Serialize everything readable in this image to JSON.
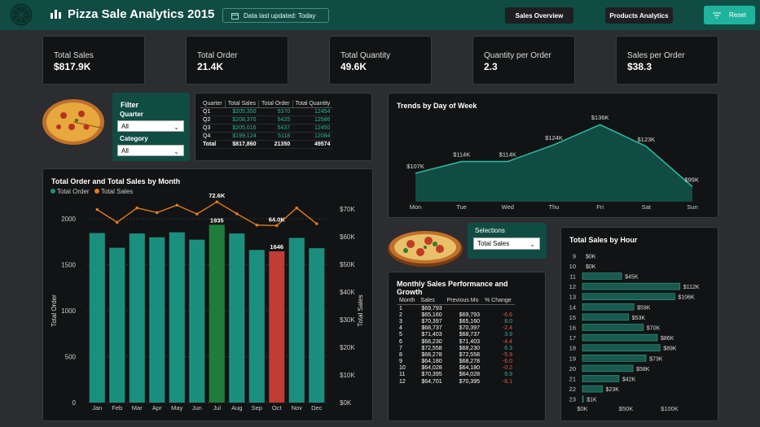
{
  "header": {
    "title": "Pizza Sale Analytics 2015",
    "updated": "Data last updated: Today",
    "nav": [
      "Sales Overview",
      "Products Analytics"
    ],
    "reset": "Reset"
  },
  "kpis": [
    {
      "label": "Total Sales",
      "value": "$817.9K"
    },
    {
      "label": "Total Order",
      "value": "21.4K"
    },
    {
      "label": "Total Quantity",
      "value": "49.6K"
    },
    {
      "label": "Quantity per Order",
      "value": "2.3"
    },
    {
      "label": "Sales per Order",
      "value": "$38.3"
    }
  ],
  "filter": {
    "title": "Filter",
    "quarter_label": "Quarter",
    "quarter_value": "All",
    "category_label": "Category",
    "category_value": "All"
  },
  "quarter_table": {
    "headers": [
      "Quarter",
      "Total Sales",
      "Total Order",
      "Total Quantity"
    ],
    "rows": [
      [
        "Q1",
        "$205,350",
        "5370",
        "12454"
      ],
      [
        "Q2",
        "$208,370",
        "5425",
        "12586"
      ],
      [
        "Q3",
        "$205,016",
        "5437",
        "12450"
      ],
      [
        "Q4",
        "$199,124",
        "5118",
        "12084"
      ],
      [
        "Total",
        "$817,860",
        "21350",
        "49574"
      ]
    ]
  },
  "selections": {
    "label": "Selections",
    "value": "Total Sales"
  },
  "monthly_perf": {
    "title": "Monthly Sales Performance and Growth",
    "headers": [
      "Month",
      "Sales",
      "Previous Mo",
      "% Change"
    ],
    "rows": [
      [
        "1",
        "$69,793",
        "",
        ""
      ],
      [
        "2",
        "$65,160",
        "$69,793",
        "-6.6"
      ],
      [
        "3",
        "$70,397",
        "$65,160",
        "8.0"
      ],
      [
        "4",
        "$68,737",
        "$70,397",
        "-2.4"
      ],
      [
        "5",
        "$71,403",
        "$68,737",
        "3.9"
      ],
      [
        "6",
        "$68,230",
        "$71,403",
        "-4.4"
      ],
      [
        "7",
        "$72,558",
        "$68,230",
        "6.3"
      ],
      [
        "8",
        "$68,278",
        "$72,558",
        "-5.9"
      ],
      [
        "9",
        "$64,180",
        "$68,278",
        "-6.0"
      ],
      [
        "10",
        "$64,028",
        "$64,180",
        "-0.2"
      ],
      [
        "11",
        "$70,395",
        "$64,028",
        "9.9"
      ],
      [
        "12",
        "$64,701",
        "$70,395",
        "-8.1"
      ]
    ],
    "colors": {
      "neg": "#e8534a",
      "pos": "#2bb59d"
    }
  },
  "chart_data": [
    {
      "type": "bar",
      "title": "Total Order and Total Sales by Month",
      "legend": [
        "Total Order",
        "Total Sales"
      ],
      "categories": [
        "Jan",
        "Feb",
        "Mar",
        "Apr",
        "May",
        "Jun",
        "Jul",
        "Aug",
        "Sep",
        "Oct",
        "Nov",
        "Dec"
      ],
      "series": [
        {
          "name": "Total Order",
          "values": [
            1845,
            1685,
            1840,
            1799,
            1853,
            1773,
            1935,
            1841,
            1661,
            1646,
            1792,
            1680
          ],
          "color": "#1b8f7e"
        },
        {
          "name": "Total Sales",
          "values": [
            69.8,
            65.2,
            70.4,
            68.7,
            71.4,
            68.2,
            72.6,
            68.3,
            64.2,
            64.0,
            70.4,
            64.7
          ],
          "color": "#e07b1a"
        }
      ],
      "highlight": {
        "max_index": 6,
        "min_index": 9,
        "max_color": "#1e7d3a",
        "min_color": "#c23b35"
      },
      "data_labels": [
        {
          "index": 6,
          "order": "1935",
          "sales": "72.6K"
        },
        {
          "index": 9,
          "order": "1646",
          "sales": "64.0K"
        }
      ],
      "ylabel": "Total Order",
      "y2label": "Total Sales",
      "yticks": [
        "0",
        "500",
        "1000",
        "1500",
        "2000"
      ],
      "y2ticks": [
        "$0K",
        "$10K",
        "$20K",
        "$30K",
        "$40K",
        "$50K",
        "$60K",
        "$70K"
      ],
      "ylim": [
        0,
        2000
      ],
      "y2lim": [
        0,
        70
      ]
    },
    {
      "type": "area",
      "title": "Trends by Day of Week",
      "categories": [
        "Mon",
        "Tue",
        "Wed",
        "Thu",
        "Fri",
        "Sat",
        "Sun"
      ],
      "values": [
        107,
        114,
        114,
        124,
        136,
        123,
        99
      ],
      "labels": [
        "$107K",
        "$114K",
        "$114K",
        "$124K",
        "$136K",
        "$123K",
        "$99K"
      ],
      "ylim": [
        90,
        140
      ],
      "color": "#1b8f7e"
    },
    {
      "type": "bar",
      "title": "Total Sales by Hour",
      "categories": [
        "9",
        "10",
        "11",
        "12",
        "13",
        "14",
        "15",
        "16",
        "17",
        "18",
        "19",
        "20",
        "21",
        "22",
        "23"
      ],
      "values": [
        0,
        0,
        45,
        112,
        106,
        59,
        53,
        70,
        86,
        89,
        73,
        58,
        42,
        23,
        1
      ],
      "labels": [
        "$0K",
        "$0K",
        "$45K",
        "$112K",
        "$106K",
        "$59K",
        "$53K",
        "$70K",
        "$86K",
        "$89K",
        "$73K",
        "$58K",
        "$42K",
        "$23K",
        "$1K"
      ],
      "xticks": [
        "$0K",
        "$50K",
        "$100K"
      ],
      "xlim": [
        0,
        100
      ],
      "color": "#1a5a4e"
    }
  ]
}
